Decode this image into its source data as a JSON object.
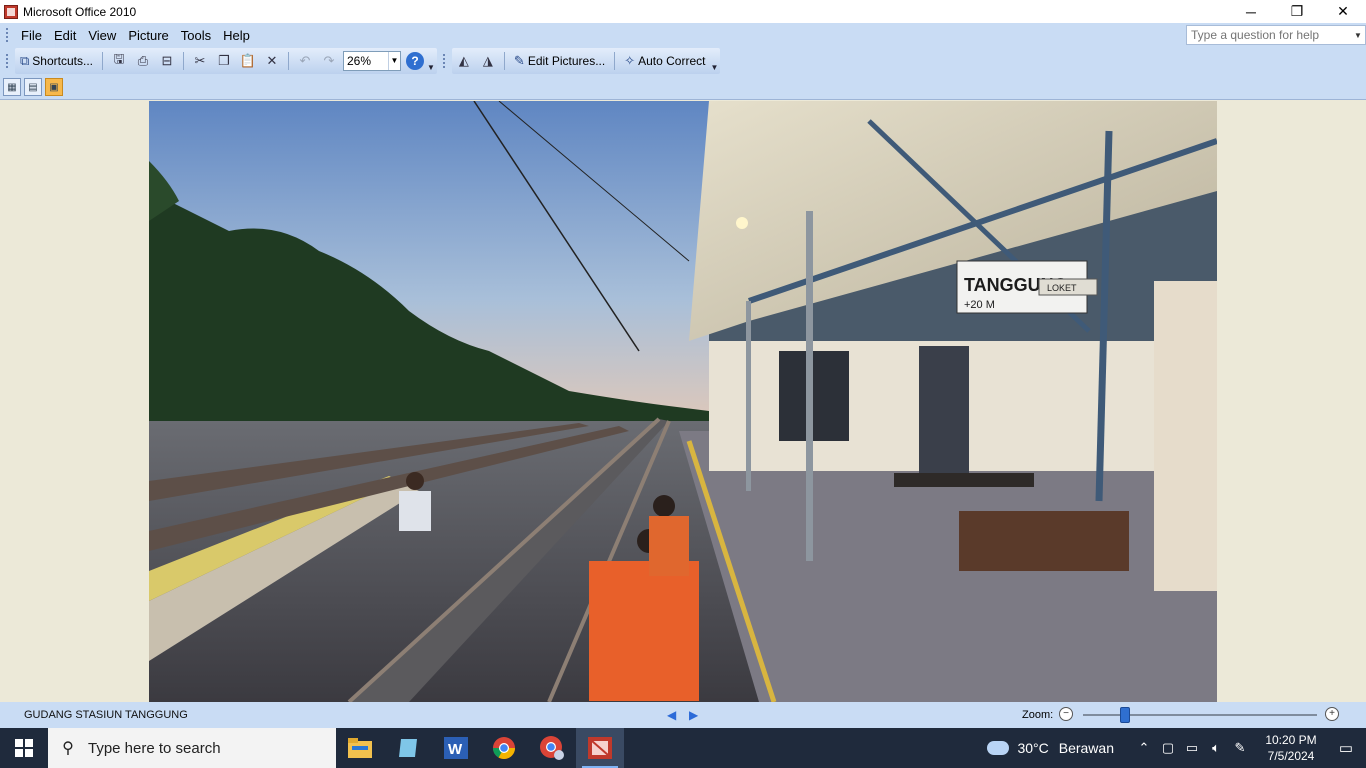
{
  "window": {
    "title": "Microsoft Office 2010",
    "minimize": "─",
    "restore": "❐",
    "close": "✕"
  },
  "menu": {
    "items": [
      {
        "label": "File"
      },
      {
        "label": "Edit"
      },
      {
        "label": "View"
      },
      {
        "label": "Picture"
      },
      {
        "label": "Tools"
      },
      {
        "label": "Help"
      }
    ],
    "help_placeholder": "Type a question for help"
  },
  "toolbar": {
    "shortcuts_label": "Shortcuts...",
    "zoom_value": "26%",
    "help_glyph": "?",
    "edit_pictures_label": "Edit Pictures...",
    "auto_correct_label": "Auto Correct"
  },
  "status": {
    "caption": "GUDANG STASIUN TANGGUNG",
    "zoom_label": "Zoom:",
    "zoom_fraction": 0.18
  },
  "taskbar": {
    "search_placeholder": "Type here to search",
    "weather_temp": "30°C",
    "weather_desc": "Berawan",
    "time": "10:20 PM",
    "date": "7/5/2024",
    "apps": [
      "file-explorer",
      "notes",
      "word",
      "chrome",
      "chrome-profile",
      "picture-manager"
    ]
  },
  "photo": {
    "sign_text": "TANGGUNG",
    "sign_sub": "+20 M",
    "loket": "LOKET"
  }
}
